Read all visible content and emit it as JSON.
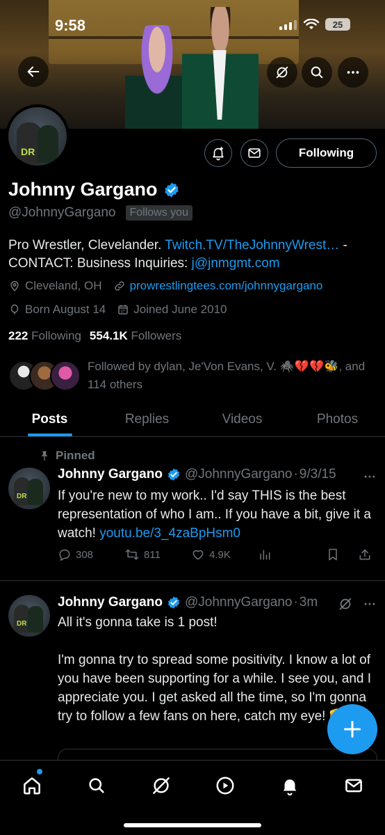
{
  "status_bar": {
    "time": "9:58",
    "battery": "25"
  },
  "profile": {
    "name": "Johnny Gargano",
    "handle": "@JohnnyGargano",
    "follows_you": "Follows you",
    "following_button": "Following",
    "bio_text": "Pro Wrestler, Clevelander. ",
    "bio_link1": "Twitch.TV/TheJohnnyWrest…",
    "bio_sep": " -",
    "bio_line2": "CONTACT: Business Inquiries: ",
    "bio_email": "j@jnmgmt.com",
    "location": "Cleveland, OH",
    "website": "prowrestlingtees.com/johnnygargano",
    "birthday": "Born August 14",
    "joined": "Joined June 2010",
    "following_count": "222",
    "following_label": "Following",
    "followers_count": "554.1K",
    "followers_label": "Followers",
    "followed_by": "Followed by dylan, Je'Von Evans, V. 🕷️💔💔🐝, and 114 others"
  },
  "tabs": [
    "Posts",
    "Replies",
    "Videos",
    "Photos"
  ],
  "posts": [
    {
      "pinned_label": "Pinned",
      "name": "Johnny Gargano",
      "handle": "@JohnnyGargano",
      "dot": "·",
      "time": "9/3/15",
      "text": "If you're new to my work.. I'd say THIS is the best representation of who I am.. If you have a bit, give it a watch! ",
      "link": "youtu.be/3_4zaBpHsm0",
      "replies": "308",
      "reposts": "811",
      "likes": "4.9K"
    },
    {
      "name": "Johnny Gargano",
      "handle": "@JohnnyGargano",
      "dot": "·",
      "time": "3m",
      "text": "All it's gonna take is 1 post!\n\nI'm gonna try to spread some positivity. I know a lot of you have been supporting for a while. I see you, and I appreciate you. I get asked all the time, so I'm gonna try to follow a few fans on here, catch my eye! 🫡"
    }
  ],
  "colors": {
    "accent": "#1d9bf0",
    "secondary_text": "#71767b",
    "background": "#000000"
  }
}
